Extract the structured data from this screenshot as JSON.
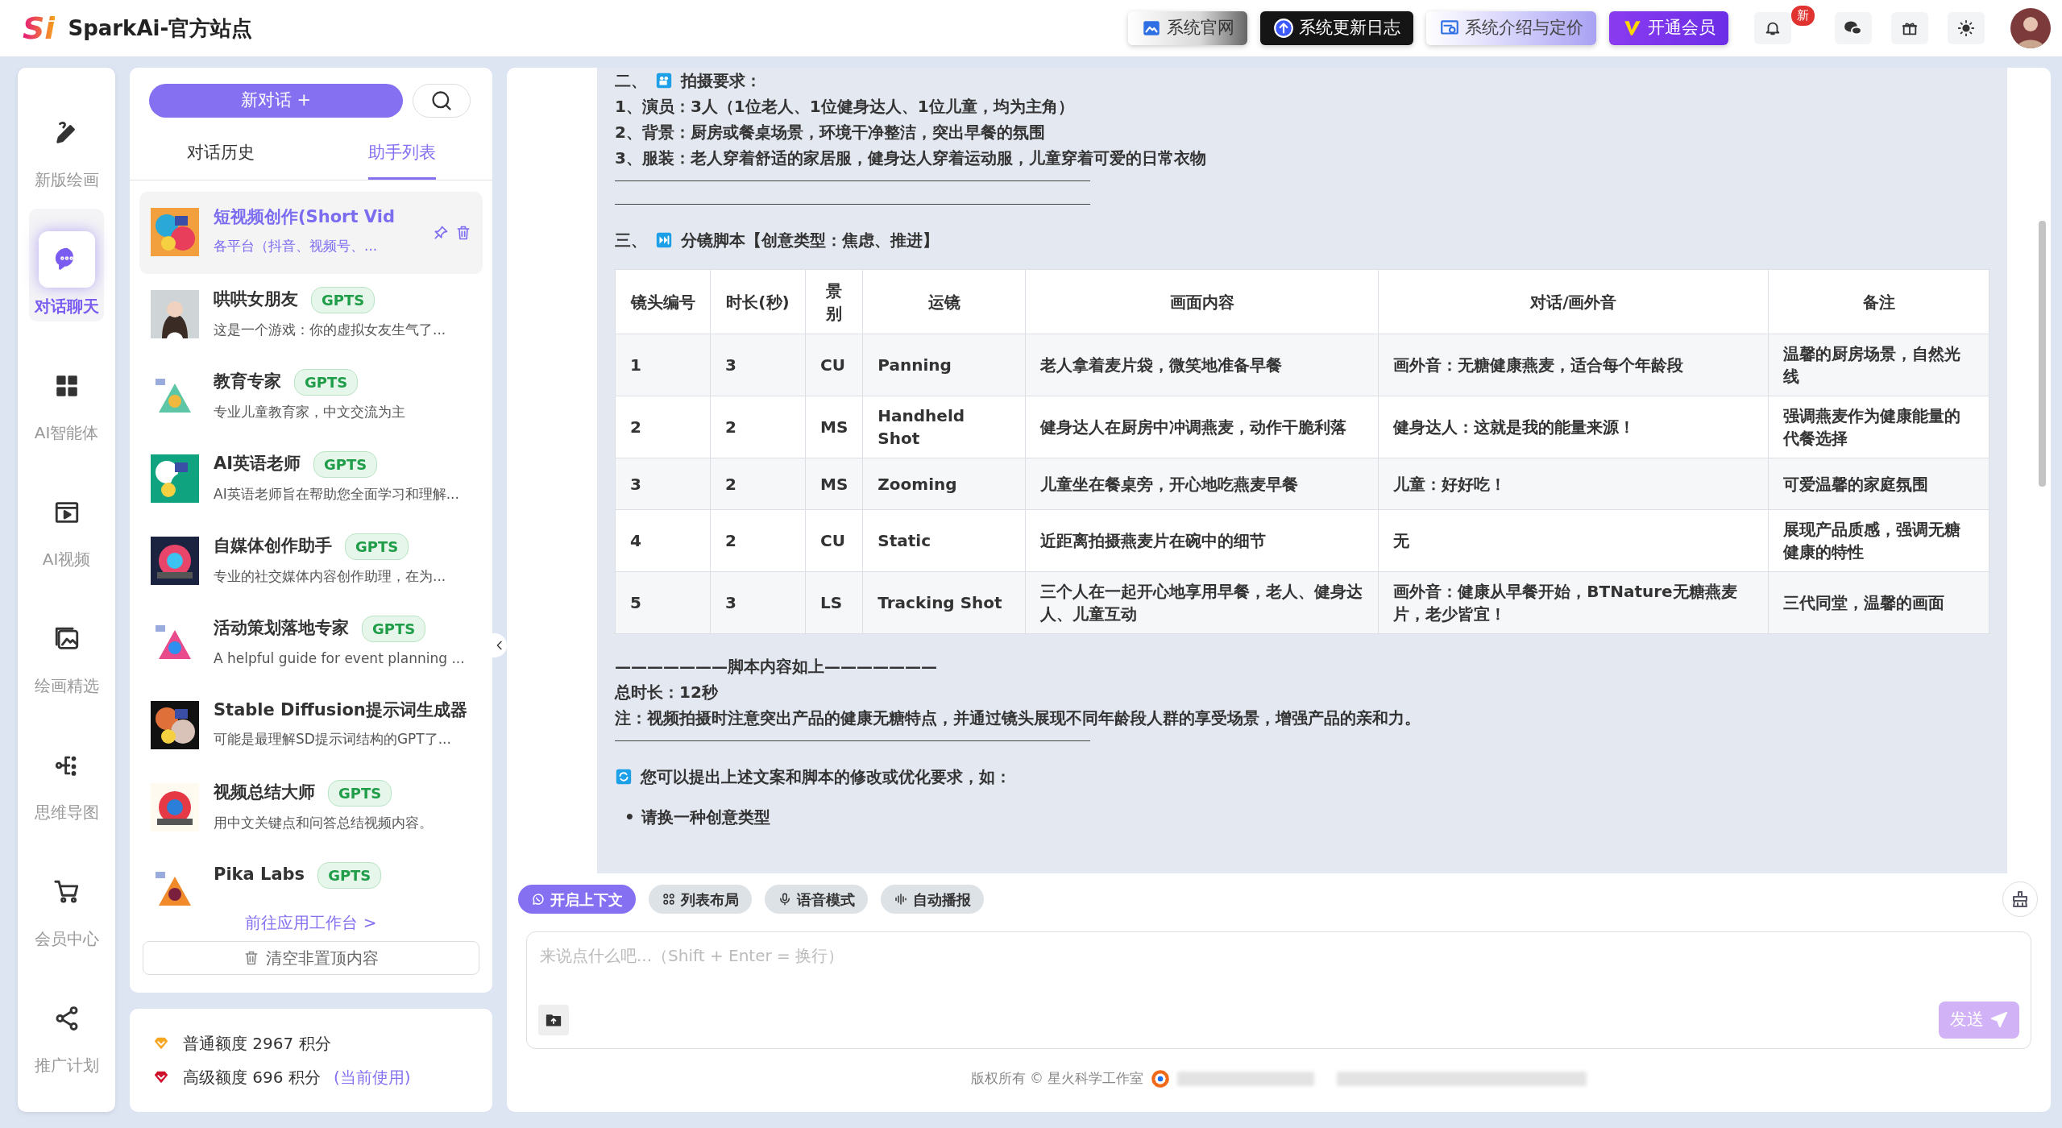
{
  "header": {
    "logo": "Si",
    "title": "SparkAi-官方站点",
    "links": [
      {
        "label": "系统官网"
      },
      {
        "label": "系统更新日志"
      },
      {
        "label": "系统介绍与定价"
      },
      {
        "label": "开通会员"
      }
    ],
    "notification_badge": "新"
  },
  "nav": [
    {
      "label": "新版绘画",
      "selected": false
    },
    {
      "label": "对话聊天",
      "selected": true
    },
    {
      "label": "AI智能体",
      "selected": false
    },
    {
      "label": "AI视频",
      "selected": false
    },
    {
      "label": "绘画精选",
      "selected": false
    },
    {
      "label": "思维导图",
      "selected": false
    },
    {
      "label": "会员中心",
      "selected": false
    },
    {
      "label": "推广计划",
      "selected": false
    }
  ],
  "sidebar": {
    "new_chat": "新对话 +",
    "tabs": [
      {
        "label": "对话历史",
        "selected": false
      },
      {
        "label": "助手列表",
        "selected": true
      }
    ],
    "assistants": [
      {
        "title": "短视频创作(Short Vid",
        "description": "各平台（抖音、视频号、...",
        "selected": true
      },
      {
        "title": "哄哄女朋友",
        "badge": "GPTS",
        "description": "这是一个游戏：你的虚拟女友生气了...",
        "selected": false
      },
      {
        "title": "教育专家",
        "badge": "GPTS",
        "description": "专业儿童教育家，中文交流为主",
        "selected": false
      },
      {
        "title": "AI英语老师",
        "badge": "GPTS",
        "description": "AI英语老师旨在帮助您全面学习和理解...",
        "selected": false
      },
      {
        "title": "自媒体创作助手",
        "badge": "GPTS",
        "description": "专业的社交媒体内容创作助理，在为...",
        "selected": false
      },
      {
        "title": "活动策划落地专家",
        "badge": "GPTS",
        "description": "A helpful guide for event planning ...",
        "selected": false
      },
      {
        "title": "Stable Diffusion提示词生成器",
        "description": "可能是最理解SD提示词结构的GPT了...",
        "selected": false
      },
      {
        "title": "视频总结大师",
        "badge": "GPTS",
        "description": "用中文关键点和问答总结视频内容。",
        "selected": false
      },
      {
        "title": "Pika Labs",
        "badge": "GPTS",
        "selected": false
      }
    ],
    "workbench_link": "前往应用工作台 >",
    "clear_button": "清空非置顶内容",
    "quota": [
      {
        "label": "普通额度 2967 积分",
        "color": "#f5a623"
      },
      {
        "label": "高级额度 696 积分",
        "note": "(当前使用)",
        "color": "#d0112b"
      }
    ]
  },
  "chat": {
    "blocks": [
      {
        "kind": "heading",
        "number": "二、",
        "text": "拍摄要求："
      },
      {
        "kind": "line",
        "text": "1、演员：3人（1位老人、1位健身达人、1位儿童，均为主角）"
      },
      {
        "kind": "line",
        "text": "2、背景：厨房或餐桌场景，环境干净整洁，突出早餐的氛围"
      },
      {
        "kind": "line",
        "text": "3、服装：老人穿着舒适的家居服，健身达人穿着运动服，儿童穿着可爱的日常衣物"
      },
      {
        "kind": "rule"
      },
      {
        "kind": "rule"
      },
      {
        "kind": "heading",
        "number": "三、",
        "text": "分镜脚本【创意类型：焦虑、推进】"
      },
      {
        "kind": "table",
        "columns": [
          "镜头编号",
          "时长(秒)",
          "景别",
          "运镜",
          "画面内容",
          "对话/画外音",
          "备注"
        ],
        "rows": [
          [
            "1",
            "3",
            "CU",
            "Panning",
            "老人拿着麦片袋，微笑地准备早餐",
            "画外音：无糖健康燕麦，适合每个年龄段",
            "温馨的厨房场景，自然光线"
          ],
          [
            "2",
            "2",
            "MS",
            "Handheld Shot",
            "健身达人在厨房中冲调燕麦，动作干脆利落",
            "健身达人：这就是我的能量来源！",
            "强调燕麦作为健康能量的代餐选择"
          ],
          [
            "3",
            "2",
            "MS",
            "Zooming",
            "儿童坐在餐桌旁，开心地吃燕麦早餐",
            "儿童：好好吃！",
            "可爱温馨的家庭氛围"
          ],
          [
            "4",
            "2",
            "CU",
            "Static",
            "近距离拍摄燕麦片在碗中的细节",
            "无",
            "展现产品质感，强调无糖健康的特性"
          ],
          [
            "5",
            "3",
            "LS",
            "Tracking Shot",
            "三个人在一起开心地享用早餐，老人、健身达人、儿童互动",
            "画外音：健康从早餐开始，BTNature无糖燕麦片，老少皆宜！",
            "三代同堂，温馨的画面"
          ]
        ]
      },
      {
        "kind": "line",
        "text": "———————脚本内容如上———————"
      },
      {
        "kind": "line",
        "text": "总时长：12秒"
      },
      {
        "kind": "line",
        "text": "注：视频拍摄时注意突出产品的健康无糖特点，并通过镜头展现不同年龄段人群的享受场景，增强产品的亲和力。"
      },
      {
        "kind": "rule"
      },
      {
        "kind": "heading",
        "text": "您可以提出上述文案和脚本的修改或优化要求，如："
      },
      {
        "kind": "bullets",
        "items": [
          {
            "marker": "•",
            "text": "请换一种创意类型"
          }
        ]
      }
    ],
    "toolbar": [
      {
        "label": "开启上下文",
        "on": true
      },
      {
        "label": "列表布局",
        "on": false
      },
      {
        "label": "语音模式",
        "on": false
      },
      {
        "label": "自动播报",
        "on": false
      }
    ],
    "input": {
      "placeholder": "来说点什么吧...（Shift + Enter = 换行）"
    },
    "send": "发送",
    "footer": "版权所有 © 星火科学工作室"
  }
}
